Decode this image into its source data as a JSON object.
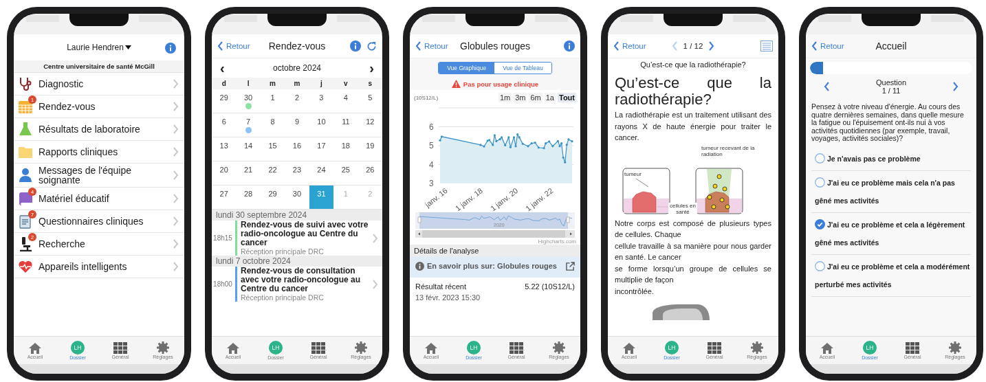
{
  "screen_profile": {
    "user_name": "Laurie Hendren",
    "institution": "Centre universitaire de santé McGill",
    "items": [
      {
        "label": "Diagnostic",
        "kind": "stethoscope"
      },
      {
        "label": "Rendez-vous",
        "kind": "calendar",
        "badge": "1"
      },
      {
        "label": "Résultats de laboratoire",
        "kind": "flask"
      },
      {
        "label": "Rapports cliniques",
        "kind": "folder"
      },
      {
        "label": "Messages de l'équipe soignante",
        "kind": "doctor"
      },
      {
        "label": "Matériel éducatif",
        "kind": "book",
        "badge": "4"
      },
      {
        "label": "Questionnaires cliniques",
        "kind": "clipboard",
        "badge": "7"
      },
      {
        "label": "Recherche",
        "kind": "microscope",
        "badge": "2"
      },
      {
        "label": "Appareils intelligents",
        "kind": "heart"
      }
    ],
    "tab_bar": [
      {
        "label": "Accueil",
        "kind": "home",
        "selected": false
      },
      {
        "label": "Dossier",
        "kind": "avatar",
        "initials": "LH",
        "selected": true
      },
      {
        "label": "Général",
        "kind": "grid",
        "selected": false
      },
      {
        "label": "Réglages",
        "kind": "gear",
        "selected": false
      }
    ]
  },
  "screen_appointments": {
    "back": "Retour",
    "title": "Rendez-vous",
    "calendar": {
      "month": "octobre 2024",
      "prev": "‹",
      "next": "›",
      "weekdays": [
        "d",
        "l",
        "m",
        "m",
        "j",
        "v",
        "s"
      ],
      "weeks": [
        {
          "days": [
            {
              "day": "29",
              "dimmed": false,
              "selected": false
            },
            {
              "day": "30",
              "dimmed": false,
              "selected": false,
              "color": "#8fe0a6"
            },
            {
              "day": "1",
              "dimmed": false,
              "selected": false
            },
            {
              "day": "2",
              "dimmed": false,
              "selected": false
            },
            {
              "day": "3",
              "dimmed": false,
              "selected": false
            },
            {
              "day": "4",
              "dimmed": false,
              "selected": false
            },
            {
              "day": "5",
              "dimmed": false,
              "selected": false
            }
          ]
        },
        {
          "days": [
            {
              "day": "6",
              "dimmed": false,
              "selected": false
            },
            {
              "day": "7",
              "dimmed": false,
              "selected": false,
              "color": "#8ec1f5"
            },
            {
              "day": "8",
              "dimmed": false,
              "selected": false
            },
            {
              "day": "9",
              "dimmed": false,
              "selected": false
            },
            {
              "day": "10",
              "dimmed": false,
              "selected": false
            },
            {
              "day": "11",
              "dimmed": false,
              "selected": false
            },
            {
              "day": "12",
              "dimmed": false,
              "selected": false
            }
          ]
        },
        {
          "days": [
            {
              "day": "13",
              "dimmed": false,
              "selected": false
            },
            {
              "day": "14",
              "dimmed": false,
              "selected": false
            },
            {
              "day": "15",
              "dimmed": false,
              "selected": false
            },
            {
              "day": "16",
              "dimmed": false,
              "selected": false
            },
            {
              "day": "17",
              "dimmed": false,
              "selected": false
            },
            {
              "day": "18",
              "dimmed": false,
              "selected": false
            },
            {
              "day": "19",
              "dimmed": false,
              "selected": false
            }
          ]
        },
        {
          "days": [
            {
              "day": "20",
              "dimmed": false,
              "selected": false
            },
            {
              "day": "21",
              "dimmed": false,
              "selected": false
            },
            {
              "day": "22",
              "dimmed": false,
              "selected": false
            },
            {
              "day": "23",
              "dimmed": false,
              "selected": false
            },
            {
              "day": "24",
              "dimmed": false,
              "selected": false
            },
            {
              "day": "25",
              "dimmed": false,
              "selected": false
            },
            {
              "day": "26",
              "dimmed": false,
              "selected": false
            }
          ]
        },
        {
          "days": [
            {
              "day": "27",
              "dimmed": false,
              "selected": false
            },
            {
              "day": "28",
              "dimmed": false,
              "selected": false
            },
            {
              "day": "29",
              "dimmed": false,
              "selected": false
            },
            {
              "day": "30",
              "dimmed": false,
              "selected": false
            },
            {
              "day": "31",
              "dimmed": false,
              "selected": true
            },
            {
              "day": "1",
              "dimmed": true,
              "selected": false
            },
            {
              "day": "2",
              "dimmed": true,
              "selected": false
            }
          ]
        }
      ]
    },
    "appointments": [
      {
        "date": "lundi 30 septembre 2024",
        "time": "18h15",
        "title": "Rendez-vous de suivi avec votre radio-oncologue au Centre du cancer",
        "location": "Réception principale DRC",
        "color": "#7ee09a"
      },
      {
        "date": "lundi 7 octobre 2024",
        "time": "18h00",
        "title": "Rendez-vous de consultation avec votre radio-oncologue au Centre du cancer",
        "location": "Réception principale DRC",
        "color": "#5aa0f0"
      }
    ],
    "tab_bar": [
      {
        "label": "Accueil",
        "kind": "home",
        "selected": false
      },
      {
        "label": "Dossier",
        "kind": "avatar",
        "initials": "LH",
        "selected": false
      },
      {
        "label": "Général",
        "kind": "grid",
        "selected": false
      },
      {
        "label": "Réglages",
        "kind": "gear",
        "selected": false
      }
    ]
  },
  "screen_lab_result": {
    "back": "Retour",
    "title": "Globules rouges",
    "views": [
      {
        "label": "Vue Graphique",
        "selected": true
      },
      {
        "label": "Vue de Tableau",
        "selected": false
      }
    ],
    "warning": "Pas pour usage clinique",
    "ranges": [
      {
        "label": "1m",
        "selected": false
      },
      {
        "label": "3m",
        "selected": false
      },
      {
        "label": "6m",
        "selected": false
      },
      {
        "label": "1a",
        "selected": false
      },
      {
        "label": "Tout",
        "selected": true
      }
    ],
    "chart_data": {
      "type": "area",
      "ylabel": "(10S12/L)",
      "categories": [
        null,
        null,
        null,
        "janv. 16",
        null,
        null,
        null,
        null,
        null,
        null,
        null,
        null,
        null,
        null,
        null,
        null,
        null,
        null,
        null,
        null,
        null,
        null,
        null,
        "1 janv. 18",
        null,
        null,
        null,
        null,
        null,
        null,
        null,
        null,
        null,
        null,
        null,
        null,
        null,
        null,
        null,
        null,
        null,
        null,
        null,
        "1 janv. 20",
        null,
        null,
        null,
        null,
        null,
        null,
        null,
        null,
        null,
        null,
        null,
        null,
        null,
        null,
        null,
        null,
        null,
        null,
        null,
        "1 janv. 22",
        null,
        null,
        null,
        null,
        null,
        null,
        null,
        null,
        null,
        null,
        null,
        null
      ],
      "series": [
        {
          "color": "#3a93c4",
          "values": [
            5.28,
            5.48,
            null,
            null,
            null,
            null,
            null,
            null,
            null,
            null,
            null,
            null,
            null,
            null,
            null,
            null,
            null,
            null,
            null,
            null,
            null,
            null,
            null,
            5.04,
            null,
            4.96,
            null,
            5.26,
            5.3,
            null,
            5.04,
            5.55,
            5.24,
            null,
            5.34,
            5.44,
            null,
            5.02,
            null,
            5.44,
            4.92,
            null,
            5.44,
            4.97,
            5.6,
            5.44,
            null,
            5.1,
            null,
            null,
            4.97,
            null,
            5.12,
            null,
            5.16,
            null,
            4.9,
            null,
            null,
            4.87,
            5.12,
            null,
            5.22,
            null,
            4.97,
            null,
            null,
            5.24,
            4.97,
            5.12,
            4.37,
            4.12,
            5.05,
            5.33,
            null,
            5.23
          ]
        }
      ],
      "ylim": [
        3,
        7
      ],
      "grid": true,
      "yticks": [
        3,
        4,
        5,
        6
      ]
    },
    "navigator_label": "2020",
    "credit": "Highcharts.com",
    "details_header": "Détails de l'analyse",
    "learn_more": "En savoir plus sur: Globules rouges",
    "recent_label": "Résultat récent",
    "recent_value": "5.22 (10S12/L)",
    "recent_date": "13 févr. 2023 15:30",
    "tab_bar": [
      {
        "label": "Accueil",
        "kind": "home",
        "selected": false
      },
      {
        "label": "Dossier",
        "kind": "avatar",
        "initials": "LH",
        "selected": true
      },
      {
        "label": "Général",
        "kind": "grid",
        "selected": false
      },
      {
        "label": "Réglages",
        "kind": "gear",
        "selected": false
      }
    ]
  },
  "screen_education": {
    "back": "Retour",
    "pager": {
      "text": "1 / 12",
      "prev_enabled": false,
      "next_enabled": true
    },
    "subtitle": "Qu’est-ce que la radiothérapie?",
    "heading": "Qu’est-ce que la radiothérapie?",
    "intro": "La radiothérapie est un traitement utilisant des rayons X de haute énergie pour traiter le cancer.",
    "figure_labels": {
      "tumor": "tumeur",
      "healthy": "cellules en santé",
      "irradiated": "tumeur recevant de la radiation"
    },
    "body": "Notre corps est composé de plusieurs types de cellules. Chaque\ncellule travaille à sa manière pour nous garder en santé. Le cancer\nse forme lorsqu’un groupe de cellules se multiplie de façon\nincontrôlée.",
    "tab_bar": [
      {
        "label": "Accueil",
        "kind": "home",
        "selected": false
      },
      {
        "label": "Dossier",
        "kind": "avatar",
        "initials": "LH",
        "selected": true
      },
      {
        "label": "Général",
        "kind": "grid",
        "selected": false
      },
      {
        "label": "Réglages",
        "kind": "gear",
        "selected": false
      }
    ]
  },
  "screen_questionnaire": {
    "back": "Retour",
    "title": "Accueil",
    "progress": {
      "level": 0.08
    },
    "question_label": "Question",
    "question_counter": "1 / 11",
    "question": "Pensez à votre niveau d'énergie. Au cours des quatre dernières semaines, dans quelle mesure la fatigue ou l'épuisement ont-ils nui à vos activités quotidiennes (par exemple, travail, voyages, activités sociales)?",
    "options": [
      {
        "label": "Je n'avais pas ce problème",
        "selected": false
      },
      {
        "label": "J'ai eu ce problème mais cela n'a pas gêné mes activités",
        "selected": false
      },
      {
        "label": "J'ai eu ce problème et cela a légèrement gêné mes activités",
        "selected": true
      },
      {
        "label": "J'ai eu ce problème et cela a modérément perturbé mes activités",
        "selected": false
      }
    ],
    "tab_bar": [
      {
        "label": "Accueil",
        "kind": "home",
        "selected": false
      },
      {
        "label": "Dossier",
        "kind": "avatar",
        "initials": "LH",
        "selected": true
      },
      {
        "label": "Général",
        "kind": "grid",
        "selected": false
      },
      {
        "label": "Réglages",
        "kind": "gear",
        "selected": false
      }
    ]
  }
}
